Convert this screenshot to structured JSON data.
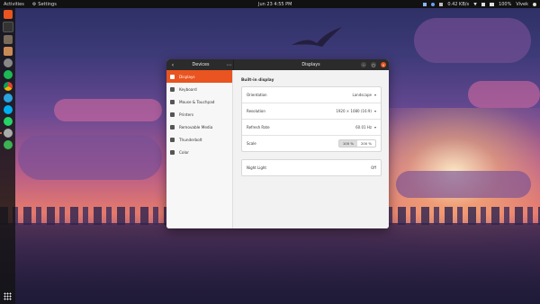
{
  "topbar": {
    "activities": "Activities",
    "app_menu": "Settings",
    "clock": "Jun 23  4:55 PM",
    "network_speed": "0.42 KB/s",
    "battery": "100%",
    "user": "Vivek"
  },
  "dock": {
    "icons": [
      "ubuntu-software-icon",
      "terminal-icon",
      "files-icon",
      "archive-icon",
      "screenshot-icon",
      "spotify-icon",
      "chrome-icon",
      "telegram-icon",
      "skype-icon",
      "whatsapp-icon",
      "settings-icon",
      "help-icon"
    ]
  },
  "window": {
    "left_title": "Devices",
    "title": "Displays",
    "nav": [
      {
        "label": "Displays"
      },
      {
        "label": "Keyboard"
      },
      {
        "label": "Mouse & Touchpad"
      },
      {
        "label": "Printers"
      },
      {
        "label": "Removable Media"
      },
      {
        "label": "Thunderbolt"
      },
      {
        "label": "Color"
      }
    ],
    "section_title": "Built-in display",
    "settings": [
      {
        "label": "Orientation",
        "value": "Landscape"
      },
      {
        "label": "Resolution",
        "value": "1920 × 1080 (16:9)"
      },
      {
        "label": "Refresh Rate",
        "value": "60.01 Hz"
      }
    ],
    "scale": {
      "label": "Scale",
      "options": [
        "100 %",
        "200 %"
      ],
      "selected": "100 %"
    },
    "night_light": {
      "label": "Night Light",
      "value": "Off"
    }
  },
  "colors": {
    "accent": "#e95420",
    "topbar": "#111111",
    "header": "#2b2b2b"
  }
}
